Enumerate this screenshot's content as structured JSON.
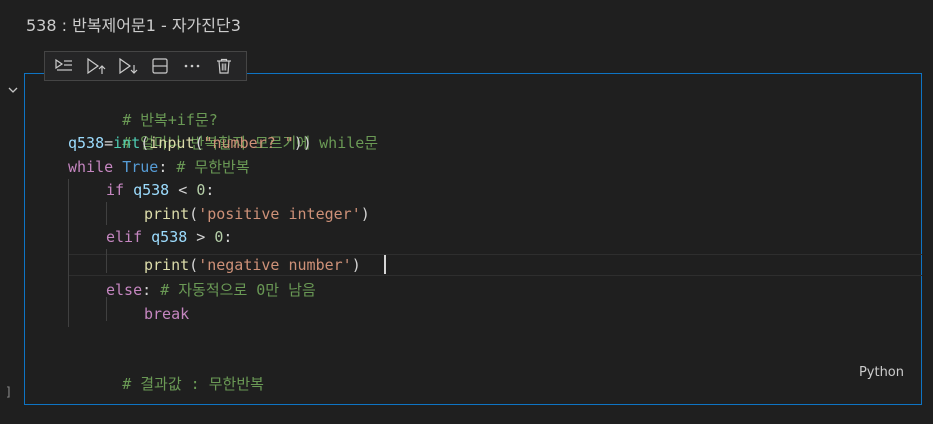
{
  "header": {
    "title": "538 : 반복제어문1 - 자가진단3"
  },
  "gutter": {
    "chevron_icon": "chevron-down-icon",
    "execution_bracket": "]"
  },
  "toolbar": {
    "items": [
      {
        "name": "run-by-line-icon"
      },
      {
        "name": "run-above-icon"
      },
      {
        "name": "run-below-icon"
      },
      {
        "name": "split-cell-icon"
      },
      {
        "name": "more-actions-icon"
      },
      {
        "name": "delete-cell-icon"
      }
    ]
  },
  "code": {
    "l1": "# 반복+if문?",
    "l2": "# 얼마나 반복할지 모르기에 while문",
    "l3_var": "q538",
    "l3_eq": "=",
    "l3_int": "int",
    "l3_p1": "(",
    "l3_input": "input",
    "l3_p2": "(",
    "l3_str": "\"number? \"",
    "l3_p3": "))",
    "l4_kw": "while",
    "l4_true": "True",
    "l4_colon": ": ",
    "l4_comment": "# 무한반복",
    "l5_kw": "if",
    "l5_var": "q538",
    "l5_op": " < ",
    "l5_num": "0",
    "l5_colon": ":",
    "l6_fn": "print",
    "l6_p1": "(",
    "l6_str": "'positive integer'",
    "l6_p2": ")",
    "l7_kw": "elif",
    "l7_var": "q538",
    "l7_op": " > ",
    "l7_num": "0",
    "l7_colon": ":",
    "l8_fn": "print",
    "l8_p1": "(",
    "l8_str": "'negative number'",
    "l8_p2": ")",
    "l9_kw": "else",
    "l9_colon": ": ",
    "l9_comment": "# 자동적으로 0만 남음",
    "l10_kw": "break",
    "l12": "# 결과값 : 무한반복"
  },
  "language": "Python",
  "colors": {
    "cell_border": "#0e74c4",
    "background": "#1f1f1f",
    "comment": "#6a9955",
    "keyword": "#c586c0",
    "string": "#ce9178"
  }
}
